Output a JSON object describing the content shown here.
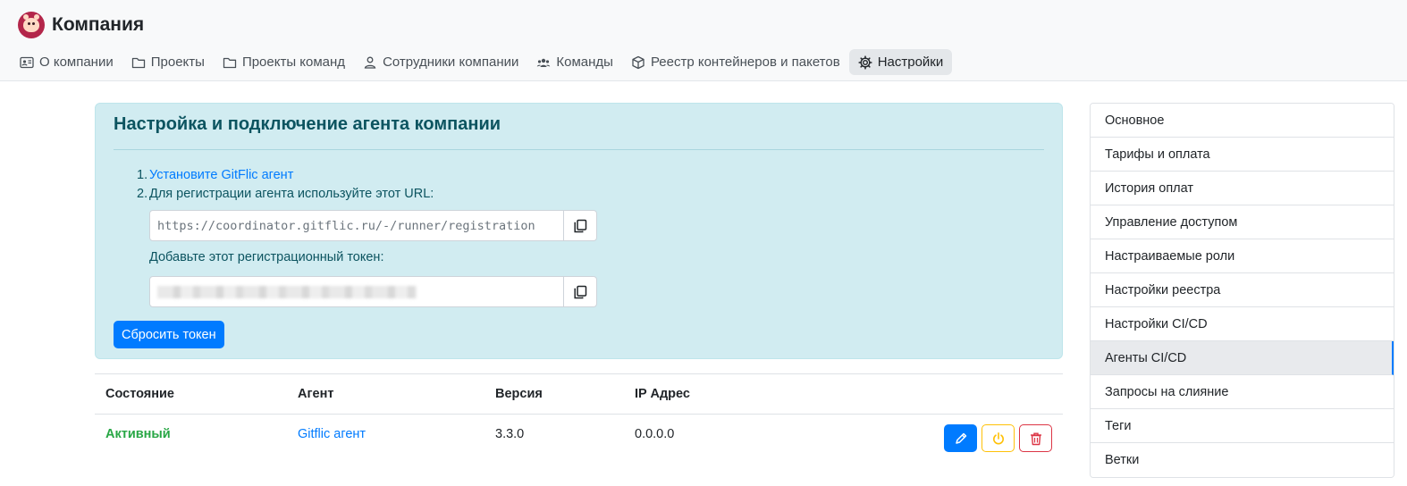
{
  "header": {
    "company": "Компания",
    "tabs": [
      {
        "label": "О компании",
        "icon": "id-card-icon",
        "active": false
      },
      {
        "label": "Проекты",
        "icon": "folder-icon",
        "active": false
      },
      {
        "label": "Проекты команд",
        "icon": "folder-icon",
        "active": false
      },
      {
        "label": "Сотрудники компании",
        "icon": "user-icon",
        "active": false
      },
      {
        "label": "Команды",
        "icon": "users-icon",
        "active": false
      },
      {
        "label": "Реестр контейнеров и пакетов",
        "icon": "box-icon",
        "active": false
      },
      {
        "label": "Настройки",
        "icon": "gear-icon",
        "active": true
      }
    ]
  },
  "agent": {
    "title": "Настройка и подключение агента компании",
    "step1_num": "1.",
    "step1_link": "Установите GitFlic агент",
    "step2_num": "2.",
    "step2_text": "Для регистрации агента используйте этот URL:",
    "url": "https://coordinator.gitflic.ru/-/runner/registration",
    "token_hint": "Добавьте этот регистрационный токен:",
    "reset_label": "Сбросить токен"
  },
  "table": {
    "headers": [
      "Состояние",
      "Агент",
      "Версия",
      "IP Адрес"
    ],
    "rows": [
      {
        "status": "Активный",
        "agent": "Gitflic агент",
        "version": "3.3.0",
        "ip": "0.0.0.0"
      }
    ]
  },
  "sidebar": {
    "items": [
      {
        "label": "Основное",
        "active": false
      },
      {
        "label": "Тарифы и оплата",
        "active": false
      },
      {
        "label": "История оплат",
        "active": false
      },
      {
        "label": "Управление доступом",
        "active": false
      },
      {
        "label": "Настраиваемые роли",
        "active": false
      },
      {
        "label": "Настройки реестра",
        "active": false
      },
      {
        "label": "Настройки CI/CD",
        "active": false
      },
      {
        "label": "Агенты CI/CD",
        "active": true
      },
      {
        "label": "Запросы на слияние",
        "active": false
      },
      {
        "label": "Теги",
        "active": false
      },
      {
        "label": "Ветки",
        "active": false
      }
    ]
  },
  "colors": {
    "accent": "#007bff",
    "success": "#28a745",
    "warning": "#ffc107",
    "danger": "#dc3545",
    "info_bg": "#d1ecf1"
  }
}
